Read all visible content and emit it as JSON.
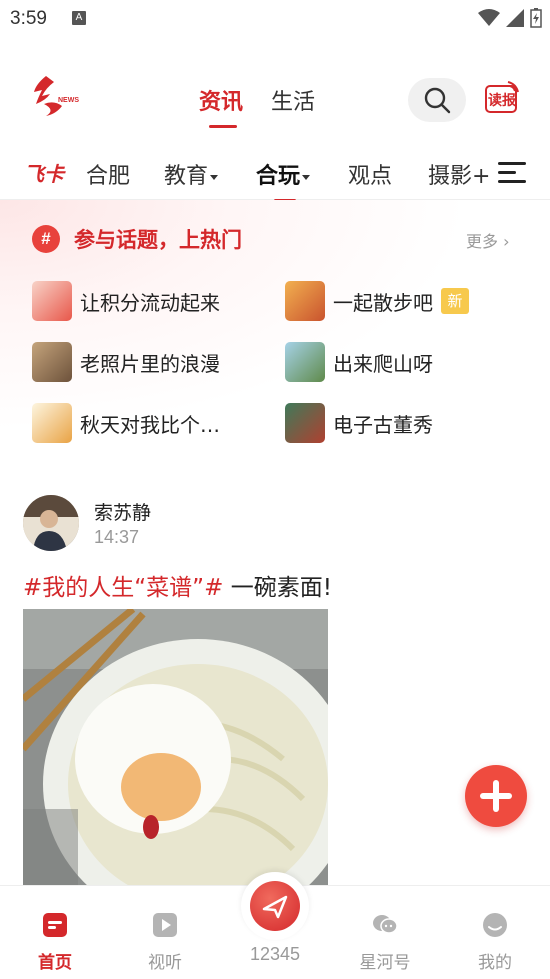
{
  "status_bar": {
    "time": "3:59",
    "notification_letter": "A"
  },
  "header": {
    "tabs": [
      {
        "label": "资讯",
        "active": true
      },
      {
        "label": "生活",
        "active": false
      }
    ],
    "read_label": "读报"
  },
  "channels": {
    "brand": "飞卡",
    "items": [
      {
        "label": "合肥"
      },
      {
        "label": "教育"
      },
      {
        "label": "合玩"
      },
      {
        "label": "观点"
      },
      {
        "label": "摄影+"
      }
    ]
  },
  "topics": {
    "icon": "#",
    "title": "参与话题，上热门",
    "more": "更多",
    "items": [
      {
        "label": "让积分流动起来"
      },
      {
        "label": "一起散步吧",
        "badge": "新"
      },
      {
        "label": "老照片里的浪漫"
      },
      {
        "label": "出来爬山呀"
      },
      {
        "label": "秋天对我比个…"
      },
      {
        "label": "电子古董秀"
      }
    ]
  },
  "post": {
    "author": "索苏静",
    "time": "14:37",
    "tag": "#我的人生“菜谱”#",
    "title": "一碗素面!"
  },
  "bottom_nav": {
    "items": [
      {
        "label": "首页",
        "active": true
      },
      {
        "label": "视听"
      },
      {
        "label": "12345"
      },
      {
        "label": "星河号"
      },
      {
        "label": "我的"
      }
    ]
  },
  "colors": {
    "brand_red": "#d4282b",
    "fab": "#ef4b3f",
    "badge_yellow": "#f7c94d"
  }
}
